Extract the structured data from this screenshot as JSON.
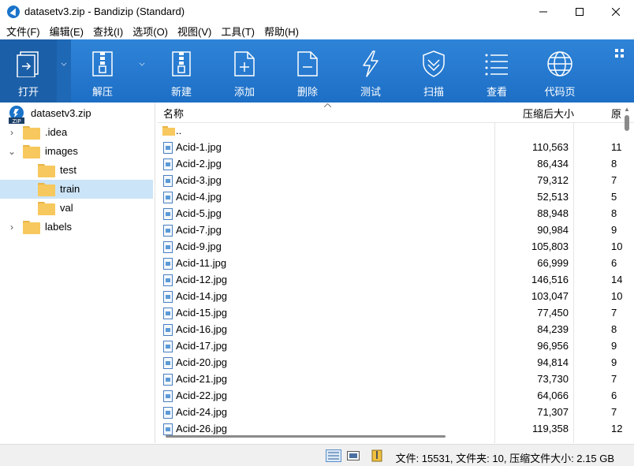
{
  "window": {
    "title": "datasetv3.zip - Bandizip (Standard)"
  },
  "menu": [
    "文件(F)",
    "编辑(E)",
    "查找(I)",
    "选项(O)",
    "视图(V)",
    "工具(T)",
    "帮助(H)"
  ],
  "toolbar": {
    "open": "打开",
    "extract": "解压",
    "new": "新建",
    "add": "添加",
    "delete": "删除",
    "test": "测试",
    "scan": "扫描",
    "view": "查看",
    "codepage": "代码页"
  },
  "tree": {
    "root": "datasetv3.zip",
    "items": [
      {
        "label": ".idea"
      },
      {
        "label": "images"
      },
      {
        "label": "test"
      },
      {
        "label": "train"
      },
      {
        "label": "val"
      },
      {
        "label": "labels"
      }
    ]
  },
  "list": {
    "columns": {
      "name": "名称",
      "packed": "压缩后大小",
      "orig": "原"
    },
    "up": "..",
    "files": [
      {
        "name": "Acid-1.jpg",
        "size": "110,563",
        "orig": "11"
      },
      {
        "name": "Acid-2.jpg",
        "size": "86,434",
        "orig": "8"
      },
      {
        "name": "Acid-3.jpg",
        "size": "79,312",
        "orig": "7"
      },
      {
        "name": "Acid-4.jpg",
        "size": "52,513",
        "orig": "5"
      },
      {
        "name": "Acid-5.jpg",
        "size": "88,948",
        "orig": "8"
      },
      {
        "name": "Acid-7.jpg",
        "size": "90,984",
        "orig": "9"
      },
      {
        "name": "Acid-9.jpg",
        "size": "105,803",
        "orig": "10"
      },
      {
        "name": "Acid-11.jpg",
        "size": "66,999",
        "orig": "6"
      },
      {
        "name": "Acid-12.jpg",
        "size": "146,516",
        "orig": "14"
      },
      {
        "name": "Acid-14.jpg",
        "size": "103,047",
        "orig": "10"
      },
      {
        "name": "Acid-15.jpg",
        "size": "77,450",
        "orig": "7"
      },
      {
        "name": "Acid-16.jpg",
        "size": "84,239",
        "orig": "8"
      },
      {
        "name": "Acid-17.jpg",
        "size": "96,956",
        "orig": "9"
      },
      {
        "name": "Acid-20.jpg",
        "size": "94,814",
        "orig": "9"
      },
      {
        "name": "Acid-21.jpg",
        "size": "73,730",
        "orig": "7"
      },
      {
        "name": "Acid-22.jpg",
        "size": "64,066",
        "orig": "6"
      },
      {
        "name": "Acid-24.jpg",
        "size": "71,307",
        "orig": "7"
      },
      {
        "name": "Acid-26.jpg",
        "size": "119,358",
        "orig": "12"
      }
    ]
  },
  "status": {
    "text": "文件: 15531, 文件夹: 10, 压缩文件大小: 2.15 GB"
  }
}
